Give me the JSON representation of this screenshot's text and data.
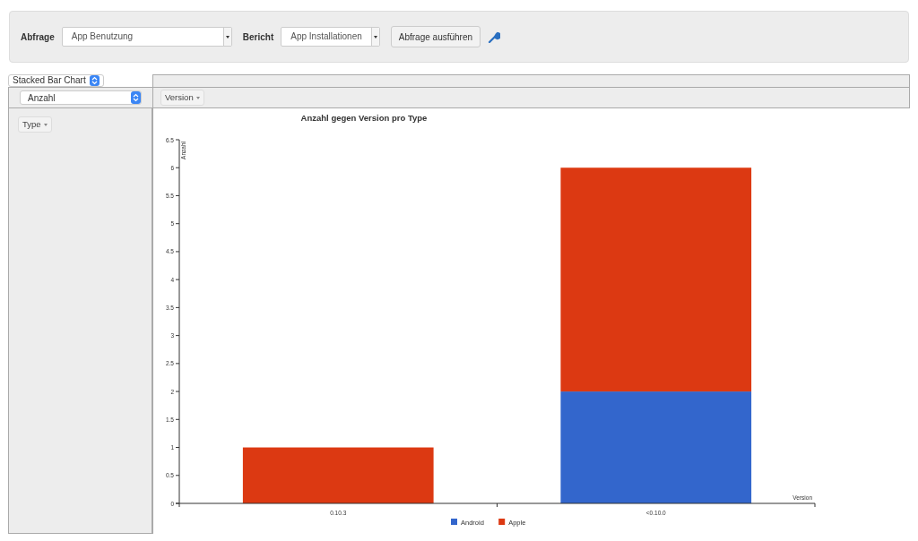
{
  "query_bar": {
    "query_label": "Abfrage",
    "query_value": "App Benutzung",
    "report_label": "Bericht",
    "report_value": "App Installationen",
    "run_button": "Abfrage ausführen"
  },
  "pivot": {
    "renderer": "Stacked Bar Chart",
    "aggregator": "Anzahl",
    "column_field": "Version",
    "row_field": "Type"
  },
  "chart": {
    "chart_data": {
      "type": "bar",
      "stacked": true,
      "title": "Anzahl gegen Version pro Type",
      "xlabel": "Version",
      "ylabel": "Anzahl",
      "categories": [
        "0.10.3",
        "<0.10.0"
      ],
      "series": [
        {
          "name": "Android",
          "color": "#3366cc",
          "values": [
            0,
            2
          ]
        },
        {
          "name": "Apple",
          "color": "#dc3912",
          "values": [
            1,
            4
          ]
        }
      ],
      "legend": true,
      "ylim": [
        0,
        6.5
      ],
      "yticks": [
        0,
        0.5,
        1,
        1.5,
        2,
        2.5,
        3,
        3.5,
        4,
        4.5,
        5,
        5.5,
        6,
        6.5
      ]
    }
  }
}
